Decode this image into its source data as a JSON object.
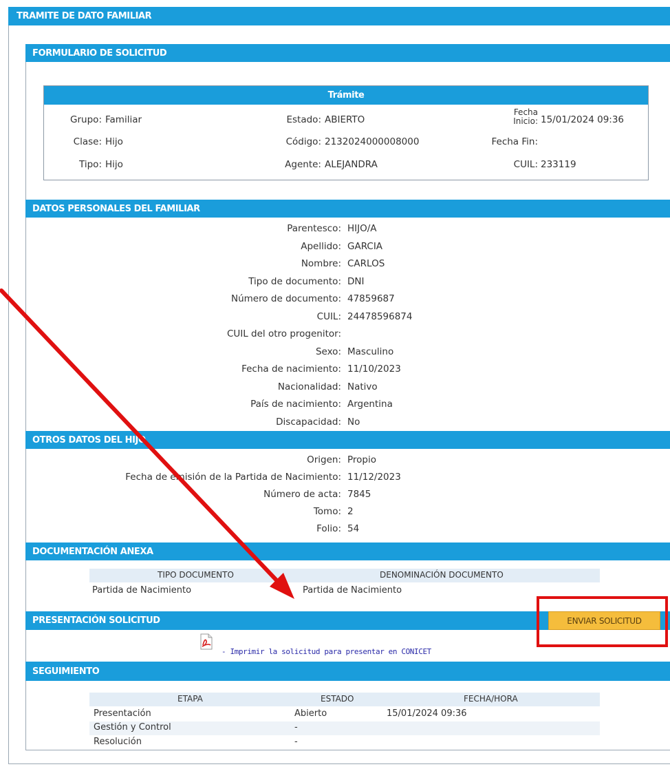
{
  "page_title": "TRAMITE DE DATO FAMILIAR",
  "form_title": "FORMULARIO DE SOLICITUD",
  "tramite": {
    "title": "Trámite",
    "grupo_label": "Grupo:",
    "grupo_value": "Familiar",
    "clase_label": "Clase:",
    "clase_value": "Hijo",
    "tipo_label": "Tipo:",
    "tipo_value": "Hijo",
    "estado_label": "Estado:",
    "estado_value": "ABIERTO",
    "codigo_label": "Código:",
    "codigo_value": "2132024000008000",
    "agente_label": "Agente:",
    "agente_value": "ALEJANDRA",
    "fecha_inicio_label_1": "Fecha",
    "fecha_inicio_label_2": "Inicio:",
    "fecha_inicio_value": "15/01/2024 09:36",
    "fecha_fin_label": "Fecha Fin:",
    "fecha_fin_value": "",
    "cuil_label": "CUIL:",
    "cuil_value": "233119"
  },
  "datos_personales": {
    "title": "DATOS PERSONALES DEL FAMILIAR",
    "rows": [
      {
        "label": "Parentesco:",
        "value": "HIJO/A"
      },
      {
        "label": "Apellido:",
        "value": "GARCIA"
      },
      {
        "label": "Nombre:",
        "value": "CARLOS"
      },
      {
        "label": "Tipo de documento:",
        "value": "DNI"
      },
      {
        "label": "Número de documento:",
        "value": "47859687"
      },
      {
        "label": "CUIL:",
        "value": "24478596874"
      },
      {
        "label": "CUIL del otro progenitor:",
        "value": ""
      },
      {
        "label": "Sexo:",
        "value": "Masculino"
      },
      {
        "label": "Fecha de nacimiento:",
        "value": "11/10/2023"
      },
      {
        "label": "Nacionalidad:",
        "value": "Nativo"
      },
      {
        "label": "País de nacimiento:",
        "value": "Argentina"
      },
      {
        "label": "Discapacidad:",
        "value": "No"
      }
    ]
  },
  "otros_datos": {
    "title": "OTROS DATOS DEL HIJO",
    "rows": [
      {
        "label": "Origen:",
        "value": "Propio"
      },
      {
        "label": "Fecha de emisión de la Partida de Nacimiento:",
        "value": "11/12/2023"
      },
      {
        "label": "Número de acta:",
        "value": "7845"
      },
      {
        "label": "Tomo:",
        "value": "2"
      },
      {
        "label": "Folio:",
        "value": "54"
      }
    ]
  },
  "documentacion": {
    "title": "DOCUMENTACIÓN ANEXA",
    "col_tipo": "TIPO DOCUMENTO",
    "col_denominacion": "DENOMINACIÓN DOCUMENTO",
    "rows": [
      {
        "tipo": "Partida de Nacimiento",
        "denominacion": "Partida de Nacimiento"
      }
    ]
  },
  "presentacion": {
    "title": "PRESENTACIÓN SOLICITUD",
    "enviar_label": "ENVIAR SOLICITUD",
    "print_link": "- Imprimir la solicitud para presentar en CONICET",
    "pdf_icon": "pdf-icon"
  },
  "seguimiento": {
    "title": "SEGUIMIENTO",
    "col_etapa": "ETAPA",
    "col_estado": "ESTADO",
    "col_fecha": "FECHA/HORA",
    "rows": [
      {
        "etapa": "Presentación",
        "estado": "Abierto",
        "fecha": "15/01/2024 09:36"
      },
      {
        "etapa": "Gestión y Control",
        "estado": "-",
        "fecha": ""
      },
      {
        "etapa": "Resolución",
        "estado": "-",
        "fecha": ""
      }
    ]
  },
  "colors": {
    "header_blue": "#1a9ddb",
    "button_yellow": "#f5bd3c",
    "annotation_red": "#e01010"
  }
}
